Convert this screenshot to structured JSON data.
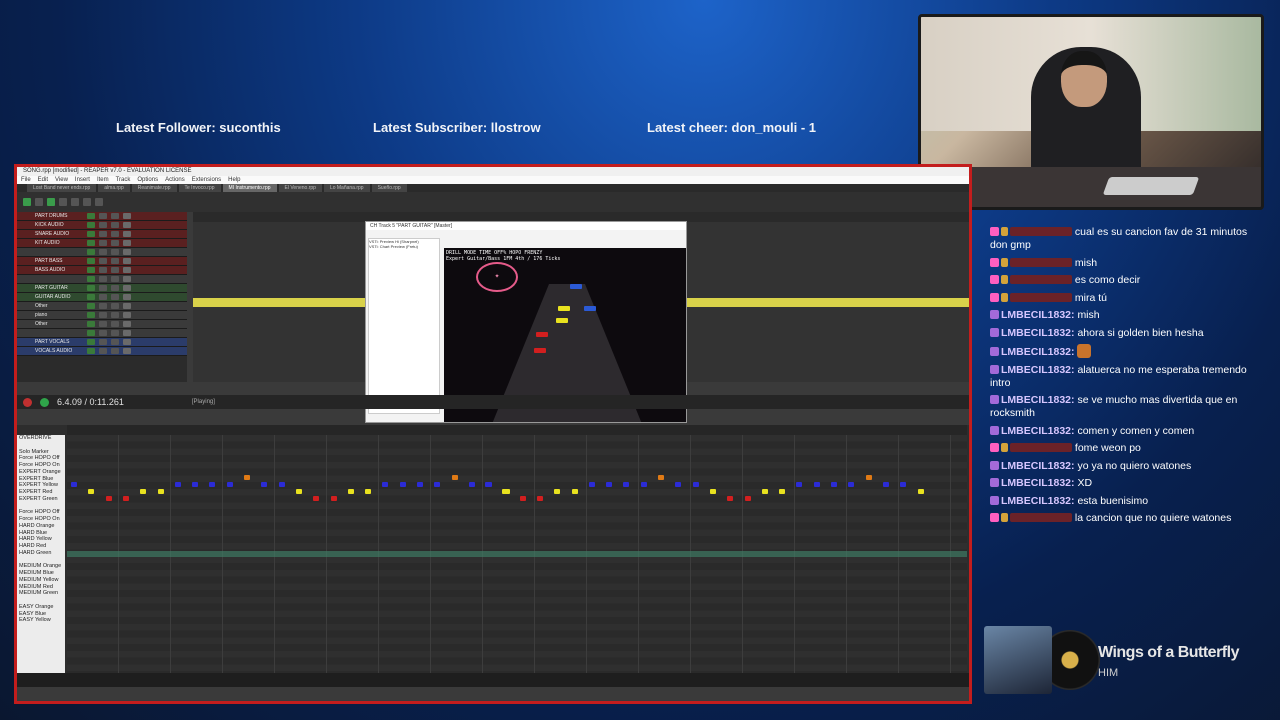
{
  "overlay": {
    "latest_follower": "Latest Follower: suconthis",
    "latest_subscriber": "Latest Subscriber: llostrow",
    "latest_cheer": "Latest cheer: don_mouli - 1"
  },
  "daw": {
    "title": "SONG.rpp [modified] - REAPER v7.0 - EVALUATION LICENSE",
    "menu": [
      "File",
      "Edit",
      "View",
      "Insert",
      "Item",
      "Track",
      "Options",
      "Actions",
      "Extensions",
      "Help"
    ],
    "tabs": [
      "Lost Band never ends.rpp",
      "alma.rpp",
      "Reanimate.rpp",
      "Te Invoco.rpp",
      "MI Instrumento.rpp",
      "El Veneno.rpp",
      "Lo Mañana.rpp",
      "Sueño.rpp"
    ],
    "tracks": [
      {
        "name": "PART DRUMS",
        "style": "red"
      },
      {
        "name": "KICK AUDIO",
        "style": "red"
      },
      {
        "name": "SNARE AUDIO",
        "style": "red"
      },
      {
        "name": "KIT AUDIO",
        "style": "red"
      },
      {
        "name": "",
        "style": "hdr"
      },
      {
        "name": "PART BASS",
        "style": "red"
      },
      {
        "name": "BASS AUDIO",
        "style": "red"
      },
      {
        "name": "",
        "style": "hdr"
      },
      {
        "name": "PART GUITAR",
        "style": "green"
      },
      {
        "name": "GUITAR AUDIO",
        "style": "green"
      },
      {
        "name": "Other",
        "style": "hdr"
      },
      {
        "name": "piano",
        "style": "hdr"
      },
      {
        "name": "Other",
        "style": "hdr"
      },
      {
        "name": "",
        "style": "hdr"
      },
      {
        "name": "PART VOCALS",
        "style": "blue"
      },
      {
        "name": "VOCALS AUDIO",
        "style": "blue"
      }
    ],
    "transport": {
      "time": "6.4.09 / 0:11.261",
      "status": "[Playing]"
    },
    "plugin": {
      "title": "CH Track 5 \"PART GUITAR\" [Master]",
      "list": [
        "VSTi: Preview Hi (Sharpnel)",
        "VSTi: Chart Preview (Fretu)"
      ],
      "hud": "DRILL MODE   TIME OFF% HOPO FRENZY\nExpert Guitar/Bass  1FM 4th / 176 Ticks"
    },
    "piano_keys": [
      "OVERDRIVE",
      "",
      "Solo Marker",
      "Force HOPO Off",
      "Force HOPO On",
      "EXPERT Orange",
      "EXPERT Blue",
      "EXPERT Yellow",
      "EXPERT Red",
      "EXPERT Green",
      "",
      "Force HOPO Off",
      "Force HOPO On",
      "HARD Orange",
      "HARD Blue",
      "HARD Yellow",
      "HARD Red",
      "HARD Green",
      "",
      "MEDIUM Orange",
      "MEDIUM Blue",
      "MEDIUM Yellow",
      "MEDIUM Red",
      "MEDIUM Green",
      "",
      "EASY Orange",
      "EASY Blue",
      "EASY Yellow"
    ]
  },
  "chat": [
    {
      "badges": [
        "pink",
        "gold"
      ],
      "user": "",
      "color": "red",
      "text": "cual es su cancion fav de 31 minutos don gmp"
    },
    {
      "badges": [
        "pink",
        "gold"
      ],
      "user": "",
      "color": "red",
      "text": "mish"
    },
    {
      "badges": [
        "pink",
        "gold"
      ],
      "user": "",
      "color": "red",
      "text": "es como decir"
    },
    {
      "badges": [
        "pink",
        "gold"
      ],
      "user": "",
      "color": "red",
      "text": "mira tú"
    },
    {
      "badges": [
        "purple"
      ],
      "user": "LMBECIL1832:",
      "color": "lilac",
      "text": "mish"
    },
    {
      "badges": [
        "purple"
      ],
      "user": "LMBECIL1832:",
      "color": "lilac",
      "text": "ahora si golden bien hesha"
    },
    {
      "badges": [
        "purple"
      ],
      "user": "LMBECIL1832:",
      "color": "lilac",
      "text": "",
      "emote": true
    },
    {
      "badges": [
        "purple"
      ],
      "user": "LMBECIL1832:",
      "color": "lilac",
      "text": "alatuerca no me esperaba tremendo intro"
    },
    {
      "badges": [
        "purple"
      ],
      "user": "LMBECIL1832:",
      "color": "lilac",
      "text": "se ve mucho mas divertida que en rocksmith"
    },
    {
      "badges": [
        "purple"
      ],
      "user": "LMBECIL1832:",
      "color": "lilac",
      "text": "comen y comen y comen"
    },
    {
      "badges": [
        "pink",
        "gold"
      ],
      "user": "",
      "color": "red",
      "text": "fome weon po"
    },
    {
      "badges": [
        "purple"
      ],
      "user": "LMBECIL1832:",
      "color": "lilac",
      "text": "yo ya no quiero watones"
    },
    {
      "badges": [
        "purple"
      ],
      "user": "LMBECIL1832:",
      "color": "lilac",
      "text": "XD"
    },
    {
      "badges": [
        "purple"
      ],
      "user": "LMBECIL1832:",
      "color": "lilac",
      "text": "esta buenisimo"
    },
    {
      "badges": [
        "pink",
        "gold"
      ],
      "user": "",
      "color": "red",
      "text": "la cancion que no quiere watones"
    }
  ],
  "now_playing": {
    "title": "Wings of a Butterfly",
    "artist": "HIM"
  },
  "colors": {
    "accent_red": "#c31d1d",
    "note_blue": "#2b2bd6",
    "note_yellow": "#e9e21f",
    "note_red": "#d21f1f",
    "note_orange": "#e07a15"
  }
}
